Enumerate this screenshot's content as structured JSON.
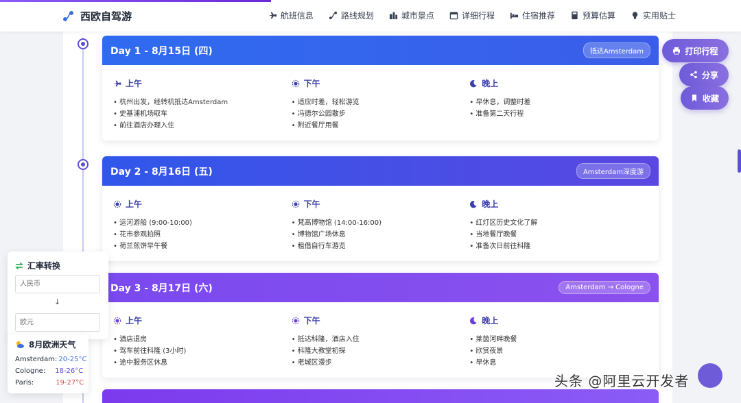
{
  "header": {
    "brand": "西欧自驾游",
    "nav": [
      {
        "label": "航班信息",
        "icon": "plane-icon"
      },
      {
        "label": "路线规划",
        "icon": "route-icon"
      },
      {
        "label": "城市景点",
        "icon": "city-icon"
      },
      {
        "label": "详细行程",
        "icon": "calendar-icon"
      },
      {
        "label": "住宿推荐",
        "icon": "bed-icon"
      },
      {
        "label": "预算估算",
        "icon": "calculator-icon"
      },
      {
        "label": "实用贴士",
        "icon": "lightbulb-icon"
      }
    ]
  },
  "days": [
    {
      "title": "Day 1 - 8月15日 (四)",
      "tag": "抵达Amsterdam",
      "morning": {
        "label": "上午",
        "icon": "plane-icon",
        "items": [
          "杭州出发，经转机抵达Amsterdam",
          "史基浦机场取车",
          "前往酒店办理入住"
        ]
      },
      "afternoon": {
        "label": "下午",
        "icon": "sun-icon",
        "items": [
          "适应时差，轻松游览",
          "冯德尔公园散步",
          "附近餐厅用餐"
        ]
      },
      "evening": {
        "label": "晚上",
        "icon": "moon-icon",
        "items": [
          "早休息，调整时差",
          "准备第二天行程"
        ]
      }
    },
    {
      "title": "Day 2 - 8月16日 (五)",
      "tag": "Amsterdam深度游",
      "morning": {
        "label": "上午",
        "icon": "sun-icon",
        "items": [
          "运河游船 (9:00-10:00)",
          "花市参观拍照",
          "荷兰煎饼早午餐"
        ]
      },
      "afternoon": {
        "label": "下午",
        "icon": "sun-icon",
        "items": [
          "梵高博物馆 (14:00-16:00)",
          "博物馆广场休息",
          "租借自行车游览"
        ]
      },
      "evening": {
        "label": "晚上",
        "icon": "moon-icon",
        "items": [
          "红灯区历史文化了解",
          "当地餐厅晚餐",
          "准备次日前往科隆"
        ]
      }
    },
    {
      "title": "Day 3 - 8月17日 (六)",
      "tag": "Amsterdam → Cologne",
      "morning": {
        "label": "上午",
        "icon": "sun-icon",
        "items": [
          "酒店退房",
          "驾车前往科隆 (3小时)",
          "途中服务区休息"
        ]
      },
      "afternoon": {
        "label": "下午",
        "icon": "sun-icon",
        "items": [
          "抵达科隆，酒店入住",
          "科隆大教堂初探",
          "老城区漫步"
        ]
      },
      "evening": {
        "label": "晚上",
        "icon": "moon-icon",
        "items": [
          "莱茵河畔晚餐",
          "欣赏夜景",
          "早休息"
        ]
      }
    }
  ],
  "actions": {
    "print": "打印行程",
    "share": "分享",
    "favorite": "收藏"
  },
  "currency": {
    "title": "汇率转换",
    "from_placeholder": "人民币",
    "to_placeholder": "欧元",
    "arrow": "↓"
  },
  "weather": {
    "title": "8月欧洲天气",
    "rows": [
      {
        "city": "Amsterdam:",
        "temp": "20-25°C",
        "color": "#3b6fe0"
      },
      {
        "city": "Cologne:",
        "temp": "18-26°C",
        "color": "#5b4fd6"
      },
      {
        "city": "Paris:",
        "temp": "19-27°C",
        "color": "#e0464b"
      }
    ]
  },
  "watermark": "头条 @阿里云开发者",
  "colors": {
    "accent": "#5b4fd6",
    "primary_blue": "#2f6bf0",
    "purple": "#8b5cf6"
  }
}
